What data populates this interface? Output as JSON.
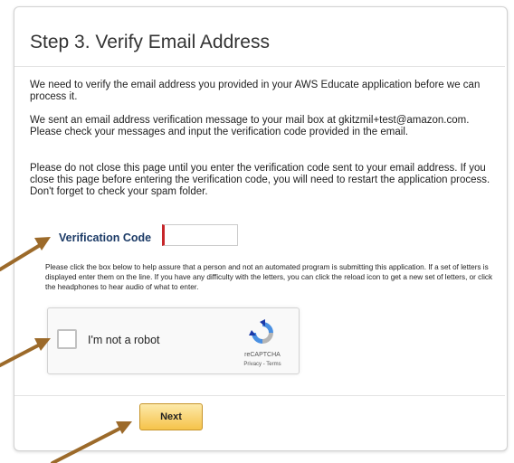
{
  "header": {
    "title": "Step 3. Verify Email Address"
  },
  "body": {
    "paragraph_1": "We need to verify the email address you provided in your AWS Educate application before we can process it.",
    "paragraph_2": "We sent an email address verification message to your mail box at gkitzmil+test@amazon.com. Please check your messages and input the verification code provided in the email.",
    "paragraph_3": "Please do not close this page until you enter the verification code sent to your email address. If you close this page before entering the verification code, you will need to restart the application process. Don't forget to check your spam folder."
  },
  "verification": {
    "label": "Verification Code",
    "value": "",
    "placeholder": ""
  },
  "captcha_instructions": "Please click the box below to help assure that a person and not an automated program is submitting this application. If a set of letters is displayed enter them on the line. If you have any difficulty with the letters, you can click the reload icon to get a new set of letters, or click the headphones to hear audio of what to enter.",
  "captcha": {
    "checkbox_label": "I'm not a robot",
    "brand": "reCAPTCHA",
    "links": "Privacy - Terms",
    "logo_icon": "recaptcha-logo-icon"
  },
  "actions": {
    "next_label": "Next"
  },
  "colors": {
    "arrow": "#9c6a2a",
    "next_button": "#f6c34a",
    "label_blue": "#1b3a66",
    "input_accent": "#c7262a"
  }
}
